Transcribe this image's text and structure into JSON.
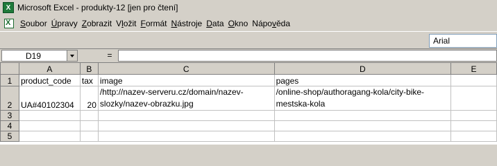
{
  "window": {
    "title": "Microsoft Excel - produkty-12  [jen pro čtení]"
  },
  "menu": [
    {
      "pre": "",
      "key": "S",
      "post": "oubor"
    },
    {
      "pre": "",
      "key": "Ú",
      "post": "pravy"
    },
    {
      "pre": "",
      "key": "Z",
      "post": "obrazit"
    },
    {
      "pre": "V",
      "key": "l",
      "post": "ožit"
    },
    {
      "pre": "",
      "key": "F",
      "post": "ormát"
    },
    {
      "pre": "",
      "key": "N",
      "post": "ástroje"
    },
    {
      "pre": "",
      "key": "D",
      "post": "ata"
    },
    {
      "pre": "",
      "key": "O",
      "post": "kno"
    },
    {
      "pre": "Nápo",
      "key": "v",
      "post": "ěda"
    }
  ],
  "toolbar": {
    "font_name": "Arial"
  },
  "formula_bar": {
    "cell_ref": "D19",
    "equals": "=",
    "formula": ""
  },
  "sheet": {
    "columns": [
      "A",
      "B",
      "C",
      "D",
      "E"
    ],
    "rows": [
      {
        "num": "1",
        "cells": [
          "product_code",
          "tax",
          "image",
          "pages",
          ""
        ]
      },
      {
        "num": "2",
        "cells": [
          "UA#40102304",
          "20",
          "/http://nazev-serveru.cz/domain/nazev-slozky/nazev-obrazku.jpg",
          "/online-shop/authoragang-kola/city-bike-mestska-kola",
          ""
        ]
      },
      {
        "num": "3",
        "cells": [
          "",
          "",
          "",
          "",
          ""
        ]
      },
      {
        "num": "4",
        "cells": [
          "",
          "",
          "",
          "",
          ""
        ]
      },
      {
        "num": "5",
        "cells": [
          "",
          "",
          "",
          "",
          ""
        ]
      }
    ]
  }
}
